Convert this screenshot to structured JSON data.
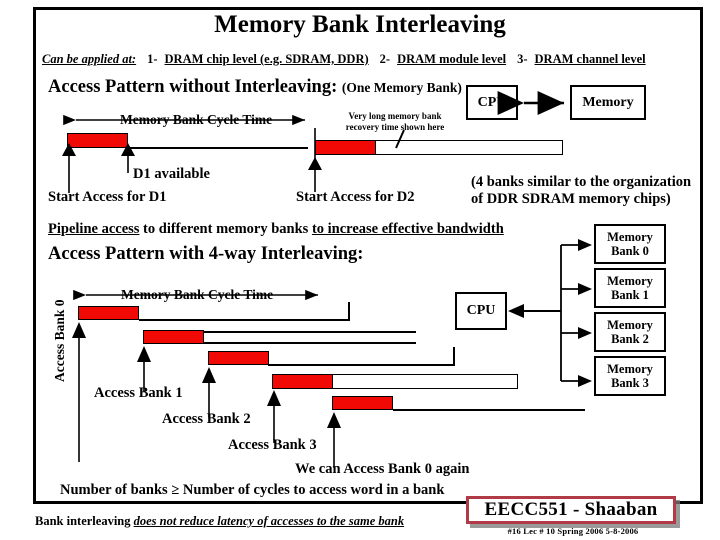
{
  "slide": {
    "title": "Memory Bank Interleaving",
    "applied_at": {
      "lead": "Can be applied at:",
      "items": [
        {
          "num": "1-",
          "text": "DRAM chip level (e.g. SDRAM, DDR)"
        },
        {
          "num": "2-",
          "text": "DRAM module level"
        },
        {
          "num": "3-",
          "text": "DRAM channel level"
        }
      ]
    },
    "section_one": {
      "heading": "Access Pattern without Interleaving:",
      "subheading": "(One Memory Bank)",
      "cycle_time_label": "Memory Bank Cycle Time",
      "recovery_note_line1": "Very long memory bank",
      "recovery_note_line2": "recovery time shown here",
      "d1_available": "D1 available",
      "start_d1": "Start Access for D1",
      "start_d2": "Start Access for D2",
      "cpu_box": "CPU",
      "memory_box": "Memory"
    },
    "ddr_note_line1": "(4 banks similar to the organization",
    "ddr_note_line2": "of DDR SDRAM memory chips)",
    "pipeline_sentence": {
      "part1": "Pipeline access",
      "part2": " to different memory banks ",
      "part3": "to increase effective bandwidth"
    },
    "section_two": {
      "heading": "Access Pattern with 4-way Interleaving:",
      "cycle_time_label": "Memory Bank Cycle Time",
      "vertical_label": "Access Bank 0",
      "bank_labels": [
        "Access Bank 1",
        "Access Bank 2",
        "Access Bank 3",
        "We can Access Bank 0 again"
      ],
      "cpu_box": "CPU",
      "memory_banks": [
        "Memory Bank 0",
        "Memory Bank 1",
        "Memory Bank 2",
        "Memory Bank 3"
      ]
    },
    "rule_of_thumb": "Number of banks  ≥  Number of cycles to access word in a bank",
    "bottom_note": {
      "prefix": "Bank interleaving ",
      "emphasis": "does not reduce latency of accesses to the same bank"
    },
    "footer": {
      "badge": "EECC551 - Shaaban",
      "sub": "#16  Lec # 10  Spring 2006  5-8-2006"
    },
    "colors": {
      "bar_red": "#f00905",
      "badge_border": "#b03a46",
      "ink": "#000000",
      "page": "#ffffff"
    }
  }
}
